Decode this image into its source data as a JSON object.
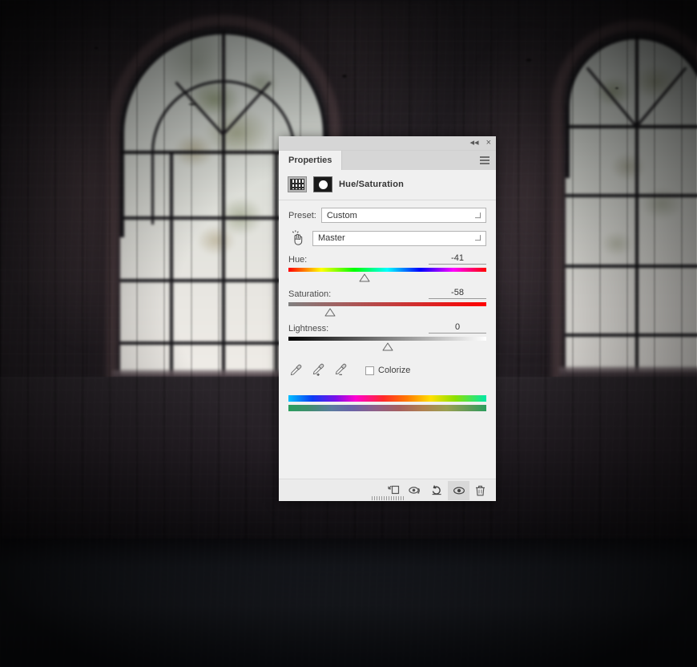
{
  "panel": {
    "topbar": {
      "collapse_icon": "double-chevron-left-icon",
      "collapse_label": "◂◂",
      "close_label": "×"
    },
    "tab": {
      "label": "Properties"
    },
    "menu_icon": "panel-menu-icon",
    "adjustment": {
      "layer_thumb_icon": "hue-saturation-thumbnail-icon",
      "mask_thumb_icon": "layer-mask-thumbnail-icon",
      "title": "Hue/Saturation"
    },
    "preset": {
      "label": "Preset:",
      "value": "Custom"
    },
    "channel": {
      "target_tool_icon": "on-image-adjustment-hand-icon",
      "value": "Master"
    },
    "sliders": [
      {
        "name": "hue-slider",
        "label": "Hue:",
        "value": "-41",
        "min": -180,
        "max": 180,
        "number": -41,
        "percent": 38.6
      },
      {
        "name": "saturation-slider",
        "label": "Saturation:",
        "value": "-58",
        "min": -100,
        "max": 100,
        "number": -58,
        "percent": 21.0
      },
      {
        "name": "lightness-slider",
        "label": "Lightness:",
        "value": "0",
        "min": -100,
        "max": 100,
        "number": 0,
        "percent": 50.0
      }
    ],
    "eyedroppers": [
      {
        "name": "eyedropper-icon",
        "title": "Sample"
      },
      {
        "name": "eyedropper-add-icon",
        "title": "Add to Sample"
      },
      {
        "name": "eyedropper-subtract-icon",
        "title": "Subtract from Sample"
      }
    ],
    "colorize": {
      "label": "Colorize",
      "checked": false
    },
    "color_bars": {
      "top_name": "input-color-spectrum-bar",
      "bottom_name": "output-color-spectrum-bar"
    },
    "footer_buttons": [
      {
        "name": "clip-to-layer-button",
        "icon": "clip-to-layer-icon",
        "active": false
      },
      {
        "name": "previous-state-button",
        "icon": "eye-previous-icon",
        "active": false
      },
      {
        "name": "reset-button",
        "icon": "reset-arrow-icon",
        "active": false
      },
      {
        "name": "toggle-visibility-button",
        "icon": "eye-icon",
        "active": true
      },
      {
        "name": "delete-button",
        "icon": "trash-icon",
        "active": false
      }
    ],
    "grip_icon": "resize-grip-icon"
  },
  "background": {
    "description": "dark-abandoned-interior-with-arched-windows",
    "colors": {
      "wall": "#272227",
      "glass": "#dfe0da",
      "mullion": "#17161a",
      "floor": "#23262e",
      "brick_tint": "#785c60"
    }
  }
}
